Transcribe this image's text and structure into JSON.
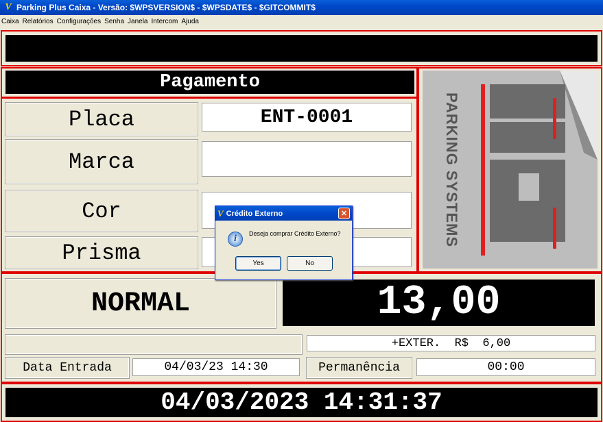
{
  "window": {
    "title": "Parking Plus Caixa - Versão: $WPSVERSION$ - $WPSDATE$ - $GITCOMMIT$",
    "app_icon": "V"
  },
  "menu": [
    "Caixa",
    "Relatórios",
    "Configurações",
    "Senha",
    "Janela",
    "Intercom",
    "Ajuda"
  ],
  "header": {
    "title": "Pagamento"
  },
  "vehicle": {
    "placa_label": "Placa",
    "placa_value": "ENT-0001",
    "marca_label": "Marca",
    "marca_value": "",
    "cor_label": "Cor",
    "cor_value": "",
    "prisma_label": "Prisma",
    "prisma_value": ""
  },
  "logo": {
    "text": "PARKING SYSTEMS"
  },
  "tariff": {
    "name": "NORMAL",
    "amount": "13,00",
    "extra": "+EXTER.  R$  6,00"
  },
  "times": {
    "entry_label": "Data Entrada",
    "entry_value": "04/03/23 14:30",
    "stay_label": "Permanência",
    "stay_value": "00:00"
  },
  "clock": "04/03/2023 14:31:37",
  "dialog": {
    "title": "Crédito Externo",
    "message": "Deseja comprar Crédito Externo?",
    "yes": "Yes",
    "no": "No",
    "close": "✕"
  }
}
